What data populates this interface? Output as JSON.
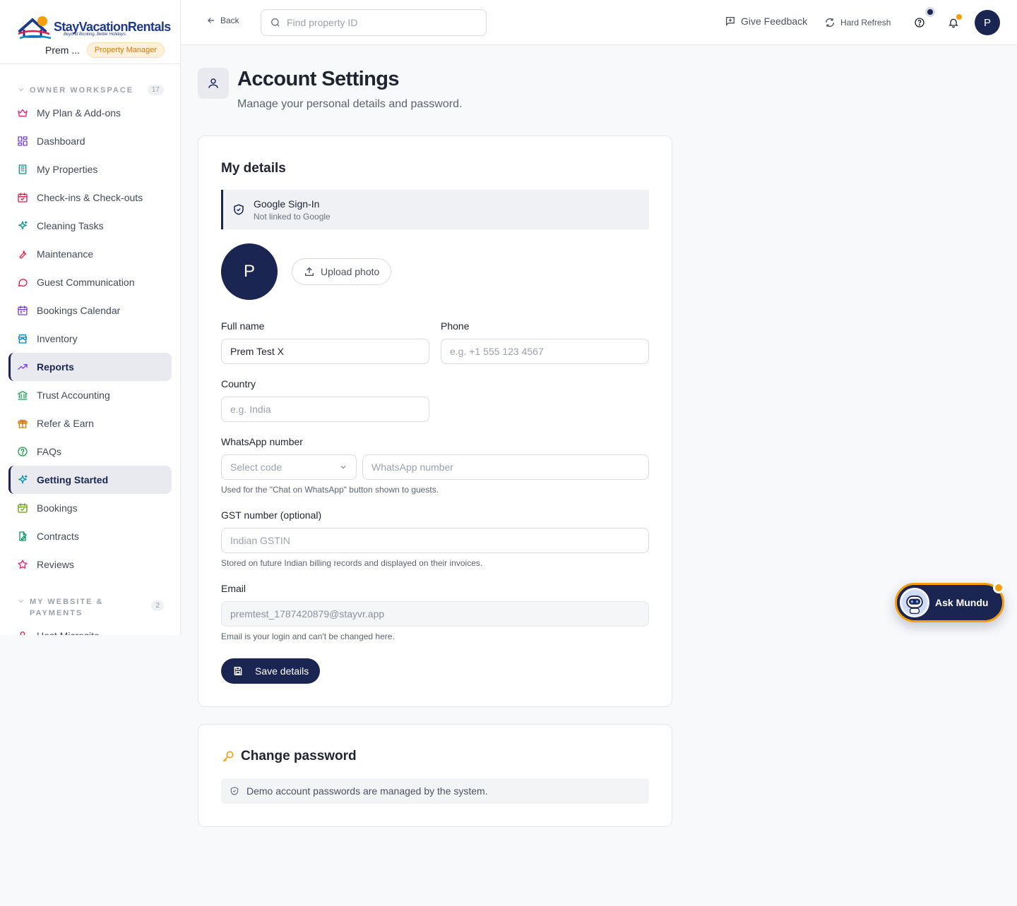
{
  "brand": {
    "name": "StayVacationRentals",
    "tagline": "Beyond Booking. Better Holidays.",
    "user_name": "Prem ...",
    "role": "Property Manager"
  },
  "sidebar": {
    "section1": {
      "label": "OWNER WORKSPACE",
      "count": "17"
    },
    "items": [
      {
        "label": "My Plan & Add-ons",
        "icon": "crown-icon",
        "color": "#db2777"
      },
      {
        "label": "Dashboard",
        "icon": "dashboard-icon",
        "color": "#7c3aed"
      },
      {
        "label": "My Properties",
        "icon": "building-icon",
        "color": "#0d9488"
      },
      {
        "label": "Check-ins & Check-outs",
        "icon": "calendar-check-icon",
        "color": "#e11d48"
      },
      {
        "label": "Cleaning Tasks",
        "icon": "sparkles-icon",
        "color": "#0d9488"
      },
      {
        "label": "Maintenance",
        "icon": "wrench-icon",
        "color": "#e11d48"
      },
      {
        "label": "Guest Communication",
        "icon": "message-icon",
        "color": "#e11d48"
      },
      {
        "label": "Bookings Calendar",
        "icon": "calendar-icon",
        "color": "#7c3aed"
      },
      {
        "label": "Inventory",
        "icon": "store-icon",
        "color": "#0284c7"
      },
      {
        "label": "Reports",
        "icon": "trending-up-icon",
        "color": "#7c3aed",
        "active": true
      },
      {
        "label": "Trust Accounting",
        "icon": "bank-icon",
        "color": "#16a34a"
      },
      {
        "label": "Refer & Earn",
        "icon": "gift-icon",
        "color": "#d97706"
      },
      {
        "label": "FAQs",
        "icon": "help-circle-icon",
        "color": "#16a34a"
      },
      {
        "label": "Getting Started",
        "icon": "sparkles-icon",
        "color": "#0891b2",
        "active": true
      },
      {
        "label": "Bookings",
        "icon": "calendar-check-icon",
        "color": "#65a30d"
      },
      {
        "label": "Contracts",
        "icon": "file-edit-icon",
        "color": "#059669"
      },
      {
        "label": "Reviews",
        "icon": "star-icon",
        "color": "#db2777"
      }
    ],
    "section2": {
      "label": "MY WEBSITE & PAYMENTS",
      "count": "2"
    },
    "items2": [
      {
        "label": "Host Microsite",
        "icon": "user-icon",
        "color": "#e11d48"
      }
    ]
  },
  "topbar": {
    "back_label": "Back",
    "search_placeholder": "Find property ID",
    "feedback_label": "Give Feedback",
    "refresh_label": "Hard Refresh",
    "avatar_initial": "P"
  },
  "page": {
    "title": "Account Settings",
    "subtitle": "Manage your personal details and password."
  },
  "details": {
    "title": "My details",
    "google_title": "Google Sign-In",
    "google_status": "Not linked to Google",
    "avatar_initial": "P",
    "upload_label": "Upload photo",
    "full_name_label": "Full name",
    "full_name_value": "Prem Test X",
    "phone_label": "Phone",
    "phone_placeholder": "e.g. +1 555 123 4567",
    "country_label": "Country",
    "country_placeholder": "e.g. India",
    "whatsapp_label": "WhatsApp number",
    "whatsapp_code_placeholder": "Select code",
    "whatsapp_placeholder": "WhatsApp number",
    "whatsapp_help": "Used for the \"Chat on WhatsApp\" button shown to guests.",
    "gst_label": "GST number (optional)",
    "gst_placeholder": "Indian GSTIN",
    "gst_help": "Stored on future Indian billing records and displayed on their invoices.",
    "email_label": "Email",
    "email_value": "premtest_1787420879@stayvr.app",
    "email_help": "Email is your login and can't be changed here.",
    "save_label": "Save details"
  },
  "password": {
    "title": "Change password",
    "note": "Demo account passwords are managed by the system."
  },
  "assistant": {
    "label": "Ask Mundu"
  },
  "colors": {
    "primary": "#1a2552",
    "accent": "#f59e0b"
  }
}
